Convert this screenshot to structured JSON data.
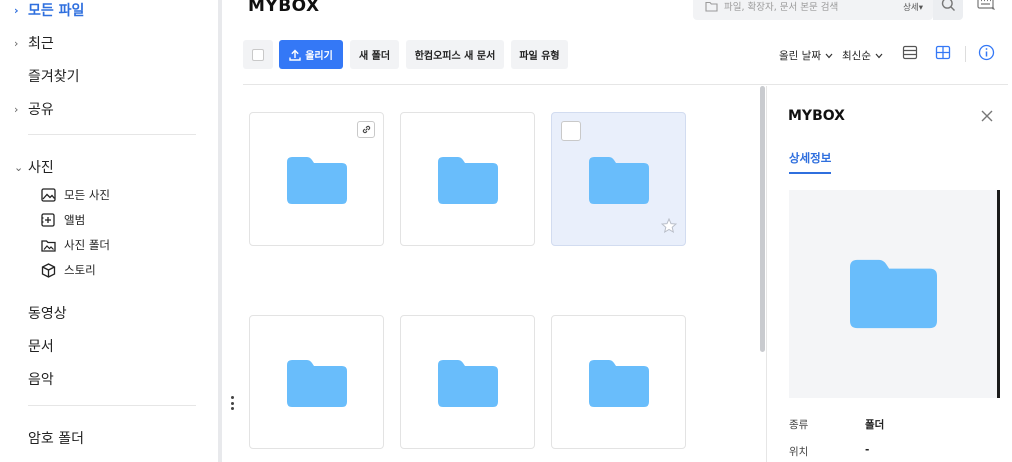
{
  "sidebar": {
    "items": [
      {
        "label": "모든 파일",
        "chevron": "›",
        "active": true
      },
      {
        "label": "최근",
        "chevron": "›"
      },
      {
        "label": "즐겨찾기",
        "chevron": ""
      },
      {
        "label": "공유",
        "chevron": "›"
      },
      {
        "label": "사진",
        "chevron": "⌄"
      },
      {
        "label": "동영상",
        "chevron": ""
      },
      {
        "label": "문서",
        "chevron": ""
      },
      {
        "label": "음악",
        "chevron": ""
      },
      {
        "label": "암호 폴더",
        "chevron": ""
      }
    ],
    "photo_sub": [
      {
        "label": "모든 사진",
        "icon": "image-icon"
      },
      {
        "label": "앨범",
        "icon": "album-add-icon"
      },
      {
        "label": "사진 폴더",
        "icon": "photo-folder-icon"
      },
      {
        "label": "스토리",
        "icon": "cube-icon"
      }
    ]
  },
  "header": {
    "title": "MYBOX",
    "search_placeholder": "파일, 확장자, 문서 본문 검색",
    "search_detail": "상세▾"
  },
  "toolbar": {
    "upload": "올리기",
    "new_folder": "새 폴더",
    "hancom_new_doc": "한컴오피스 새 문서",
    "file_type": "파일 유형",
    "sort_field": "올린 날짜",
    "sort_order": "최신순"
  },
  "grid": {
    "cards": [
      {
        "type": "folder",
        "shared_link": true,
        "selected": false
      },
      {
        "type": "folder",
        "shared_link": false,
        "selected": false
      },
      {
        "type": "folder",
        "shared_link": false,
        "selected": true
      },
      {
        "type": "folder",
        "shared_link": false,
        "selected": false
      },
      {
        "type": "folder",
        "shared_link": false,
        "selected": false
      },
      {
        "type": "folder",
        "shared_link": false,
        "selected": false
      }
    ]
  },
  "panel": {
    "title": "MYBOX",
    "tab": "상세정보",
    "props": [
      {
        "label": "종류",
        "value": "폴더"
      },
      {
        "label": "위치",
        "value": "-"
      }
    ]
  },
  "colors": {
    "accent": "#3478f6",
    "link_active": "#2f6fde",
    "folder": "#69bdfb",
    "selected_bg": "#e9effb"
  }
}
